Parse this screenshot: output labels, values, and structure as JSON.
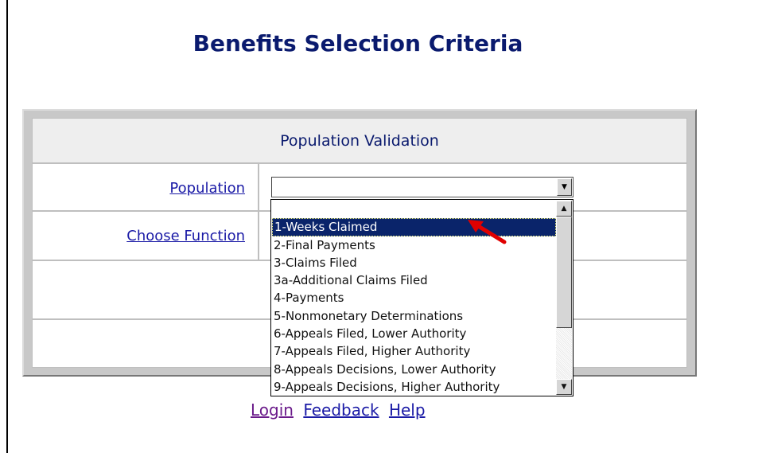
{
  "page": {
    "title": "Benefits Selection Criteria"
  },
  "form": {
    "header": "Population Validation",
    "population_label": "Population",
    "function_label": "Choose Function",
    "population_value": ""
  },
  "dropdown": {
    "options": [
      "",
      "1-Weeks Claimed",
      "2-Final Payments",
      "3-Claims Filed",
      "3a-Additional Claims Filed",
      "4-Payments",
      "5-Nonmonetary Determinations",
      "6-Appeals Filed, Lower Authority",
      "7-Appeals Filed, Higher Authority",
      "8-Appeals Decisions, Lower Authority",
      "9-Appeals Decisions, Higher Authority"
    ],
    "highlighted": "1-Weeks Claimed",
    "annotation_color": "#e00000"
  },
  "footer": {
    "login": "Login",
    "feedback": "Feedback",
    "help": "Help"
  },
  "colors": {
    "title": "#0a1a6e",
    "link": "#1a1aa6",
    "visited_link": "#6a1a8a",
    "selection": "#0a246a"
  }
}
